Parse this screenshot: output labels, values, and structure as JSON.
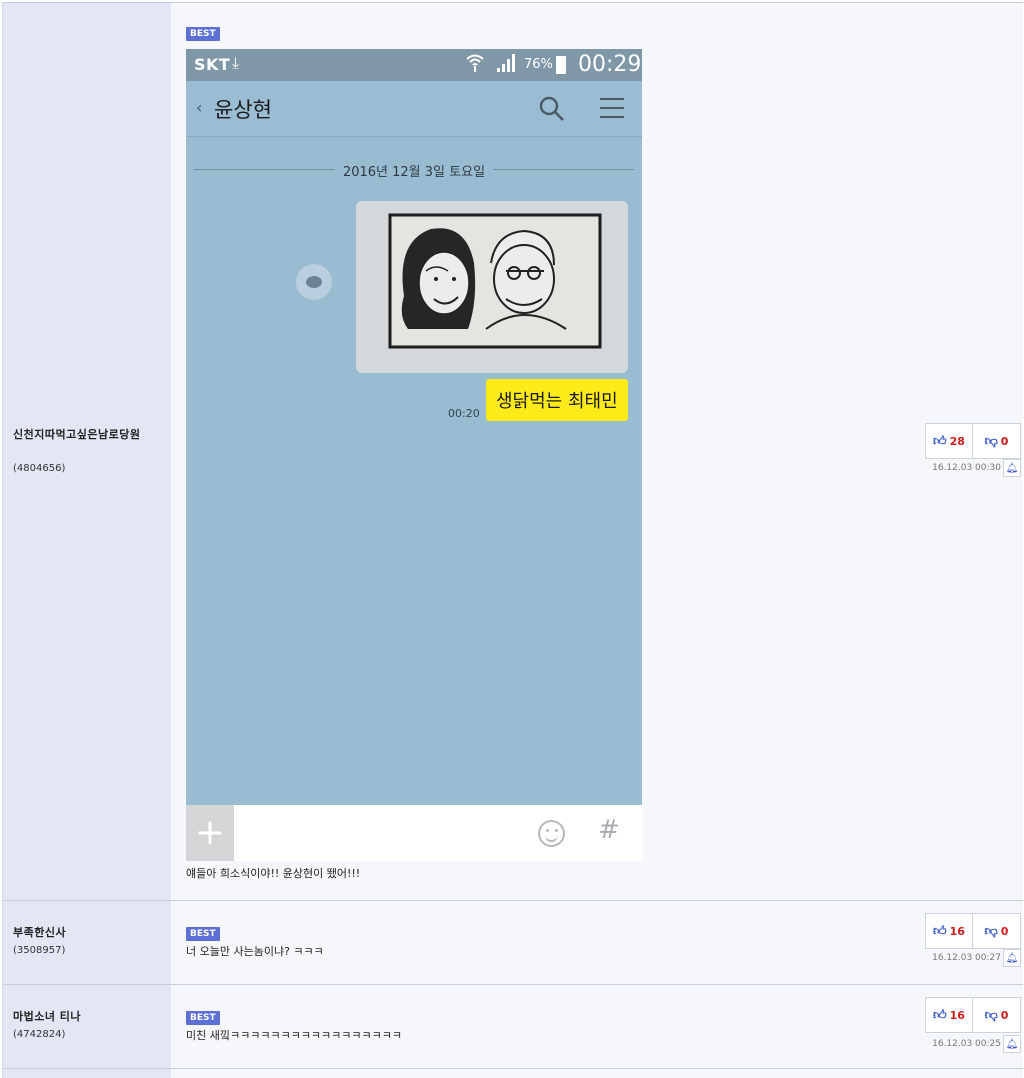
{
  "comments": [
    {
      "nickname": "신천지따먹고싶은남로당원",
      "user_id": "(4804656)",
      "best_label": "BEST",
      "text": "얘들아 희소식이야!! 윤상현이 뙜어!!!",
      "up": "28",
      "down": "0",
      "date": "16.12.03 00:30"
    },
    {
      "nickname": "부족한신사",
      "user_id": "(3508957)",
      "best_label": "BEST",
      "text": "너 오늘만 사는놈이냐? ㅋㅋㅋ",
      "up": "16",
      "down": "0",
      "date": "16.12.03 00:27"
    },
    {
      "nickname": "마법소녀 티나",
      "user_id": "(4742824)",
      "best_label": "BEST",
      "text": "미친 새낔ㅋㅋㅋㅋㅋㅋㅋㅋㅋㅋㅋㅋㅋㅋㅋㅋㅋ",
      "up": "16",
      "down": "0",
      "date": "16.12.03 00:25"
    }
  ],
  "chat_screenshot": {
    "carrier": "SKT",
    "battery": "76%",
    "time": "00:29",
    "room_title": "윤상현",
    "date_divider": "2016년 12월 3일 토요일",
    "message_text": "생닭먹는 최태민",
    "message_time": "00:20",
    "icons": [
      "download-icon",
      "wifi-icon",
      "signal-icon",
      "battery-icon",
      "back-icon",
      "search-icon",
      "menu-icon",
      "share-icon",
      "plus-button",
      "emoji-icon",
      "hashtag-icon"
    ]
  },
  "colors": {
    "best_badge": "#5b6fd6",
    "side_bg": "#e3e7f5",
    "chat_bg": "#9abcd1",
    "message_bubble": "#fcea19",
    "vote_count": "#d01b1b"
  }
}
